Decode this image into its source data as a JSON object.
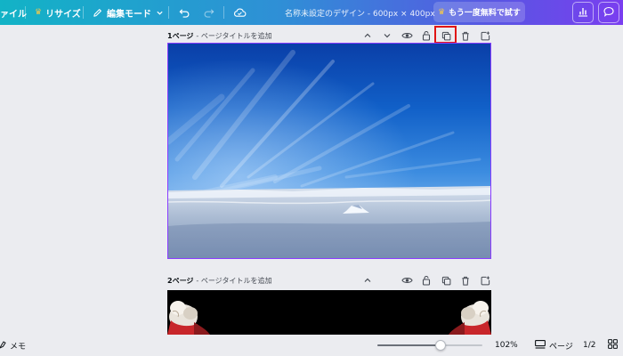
{
  "topbar": {
    "file_label": "ァイル",
    "resize_label": "リサイズ",
    "edit_mode_label": "編集モード",
    "doc_title": "名称未設定のデザイン - 600px × 400px",
    "trial_button_label": "もう一度無料で試す"
  },
  "pages": [
    {
      "number_label": "1ページ",
      "title_placeholder": "- ページタイトルを追加"
    },
    {
      "number_label": "2ページ",
      "title_placeholder": "- ページタイトルを追加"
    }
  ],
  "bottombar": {
    "notes_label": "メモ",
    "zoom_value": "102%",
    "zoom_fraction": 0.6,
    "pages_label": "ページ",
    "page_count": "1/2"
  },
  "colors": {
    "topbar_gradient_start": "#12b3c6",
    "topbar_gradient_end": "#7a3ef0",
    "selection_border": "#8b3dff",
    "annotation_highlight": "#e01414"
  }
}
